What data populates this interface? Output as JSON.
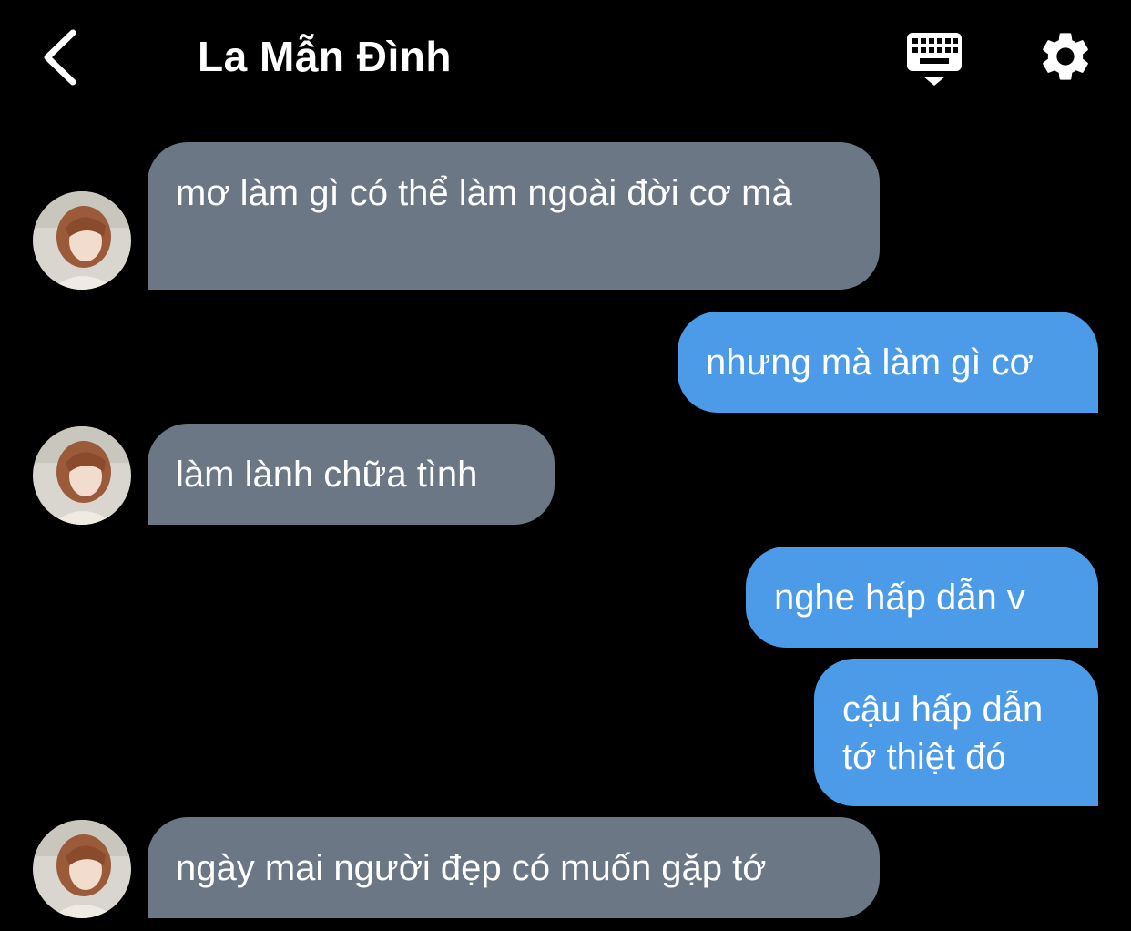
{
  "header": {
    "title": "La Mẫn Đình",
    "back_icon": "chevron-left-icon",
    "keyboard_icon": "keyboard-hide-icon",
    "settings_icon": "gear-icon"
  },
  "colors": {
    "background": "#000000",
    "incoming_bubble": "#6b7785",
    "outgoing_bubble": "#4b9be8",
    "text": "#ffffff"
  },
  "messages": [
    {
      "sender": "contact",
      "text": "mơ làm gì có thể làm ngoài đời cơ mà"
    },
    {
      "sender": "me",
      "text": "nhưng mà làm gì cơ"
    },
    {
      "sender": "contact",
      "text": "làm lành chữa tình"
    },
    {
      "sender": "me",
      "text": "nghe hấp dẫn v"
    },
    {
      "sender": "me",
      "text": "cậu hấp dẫn tớ thiệt đó"
    },
    {
      "sender": "contact",
      "text": "ngày mai người đẹp có muốn gặp tớ"
    }
  ]
}
